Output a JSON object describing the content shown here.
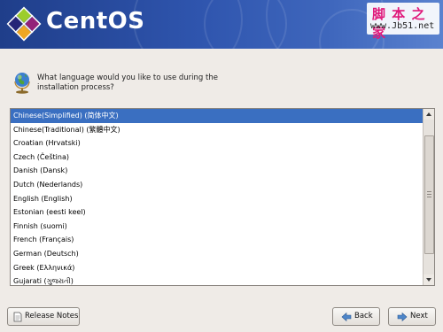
{
  "header": {
    "brand": "CentOS",
    "watermark_line1": "脚 本 之 家",
    "watermark_line2": "www.Jb51.net"
  },
  "prompt": {
    "text": "What language would you like to use during the installation process?",
    "icon": "globe-icon"
  },
  "language_list": {
    "selected_index": 0,
    "items": [
      "Chinese(Simplified) (简体中文)",
      "Chinese(Traditional) (繁體中文)",
      "Croatian (Hrvatski)",
      "Czech (Čeština)",
      "Danish (Dansk)",
      "Dutch (Nederlands)",
      "English (English)",
      "Estonian (eesti keel)",
      "Finnish (suomi)",
      "French (Français)",
      "German (Deutsch)",
      "Greek (Ελληνικά)",
      "Gujarati (ગુજરાતી)"
    ]
  },
  "buttons": {
    "release_notes": "Release Notes",
    "back": "Back",
    "next": "Next"
  },
  "colors": {
    "banner": "#2f55ae",
    "selection": "#3a6fc1",
    "background": "#efebe7"
  }
}
